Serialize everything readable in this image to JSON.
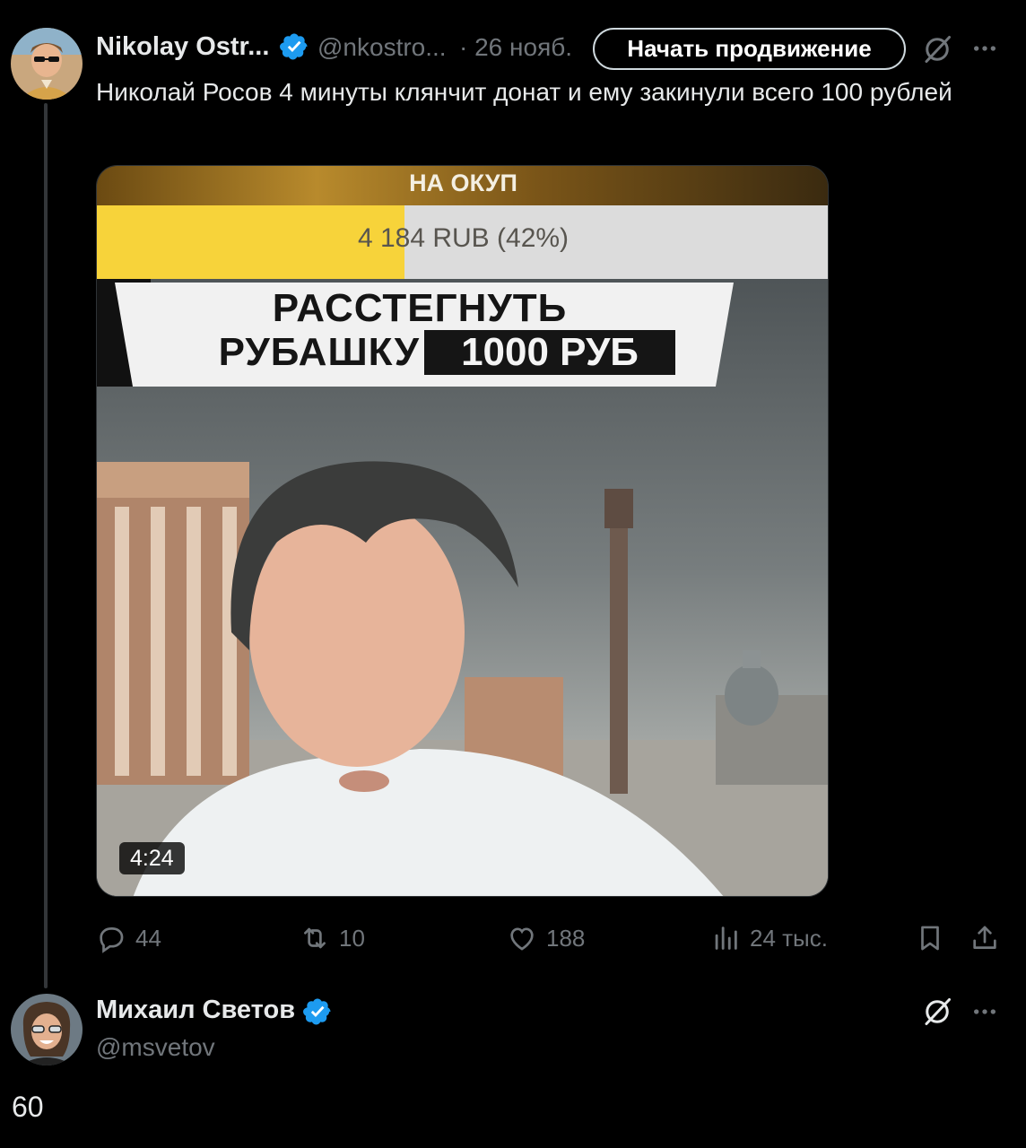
{
  "tweet": {
    "author_name": "Nikolay Ostr...",
    "handle": "@nkostro...",
    "date": "· 26 нояб.",
    "promote_label": "Начать продвижение",
    "text": "Николай Росов 4 минуты клянчит донат и ему закинули всего 100 рублей",
    "video": {
      "duration": "4:24",
      "overlay_title": "НА ОКУП",
      "progress_text": "4 184 RUB (42%)",
      "progress_fraction": 0.42,
      "banner_line1": "РАССТЕГНУТЬ",
      "banner_line2": "РУБАШКУ",
      "banner_price": "1000 РУБ"
    },
    "stats": {
      "replies": "44",
      "reposts": "10",
      "likes": "188",
      "views": "24 тыс."
    }
  },
  "reply": {
    "author_name": "Михаил Светов",
    "handle": "@msvetov",
    "text": "60"
  },
  "colors": {
    "background": "#000000",
    "text": "#e7e9ea",
    "muted": "#71767b",
    "verified": "#1d9bf0",
    "progress_fill": "#f7d33a"
  }
}
